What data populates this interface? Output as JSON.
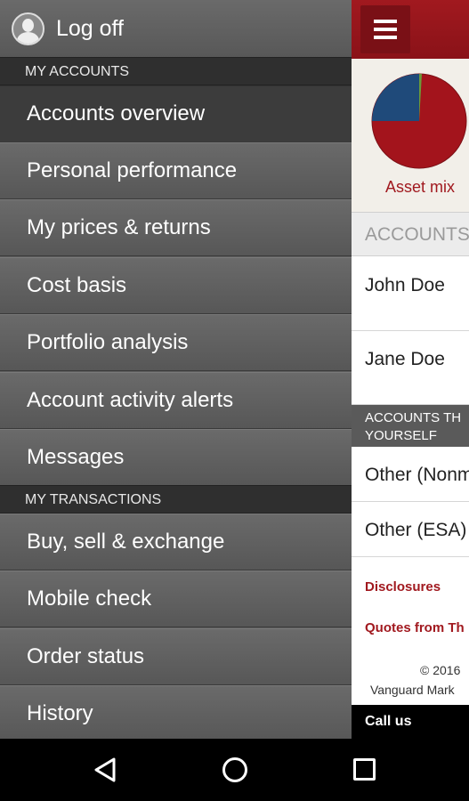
{
  "drawer": {
    "logoff_label": "Log off",
    "section_accounts": "MY ACCOUNTS",
    "accounts_items": [
      {
        "label": "Accounts overview",
        "active": true
      },
      {
        "label": "Personal performance"
      },
      {
        "label": "My prices & returns"
      },
      {
        "label": "Cost basis"
      },
      {
        "label": "Portfolio analysis"
      },
      {
        "label": "Account activity alerts"
      },
      {
        "label": "Messages"
      }
    ],
    "section_transactions": "MY TRANSACTIONS",
    "transactions_items": [
      {
        "label": "Buy, sell & exchange"
      },
      {
        "label": "Mobile check"
      },
      {
        "label": "Order status"
      },
      {
        "label": "History"
      }
    ]
  },
  "main": {
    "menu_icon": "hamburger-menu-icon",
    "asset_mix_label": "Asset mix",
    "pie_colors": {
      "red": "#a3141c",
      "blue": "#1f4a7a",
      "green": "#6a9a3a"
    },
    "accounts_header": "ACCOUNTS",
    "accounts": [
      "John Doe",
      "Jane Doe"
    ],
    "self_header_line1": "ACCOUNTS TH",
    "self_header_line2": "YOURSELF",
    "other_accounts": [
      "Other (Nonm",
      "Other (ESA)"
    ],
    "disclosures": "Disclosures",
    "quotes": "Quotes from Th",
    "copyright": "© 2016",
    "vanguard": "Vanguard Mark",
    "call_us": "Call us"
  },
  "android_nav": {
    "back": "back-icon",
    "home": "home-icon",
    "recents": "recents-icon"
  },
  "colors": {
    "brand_red": "#a1191f",
    "drawer_bg": "#5e5e5e",
    "section_bg": "#2f2f2f"
  }
}
